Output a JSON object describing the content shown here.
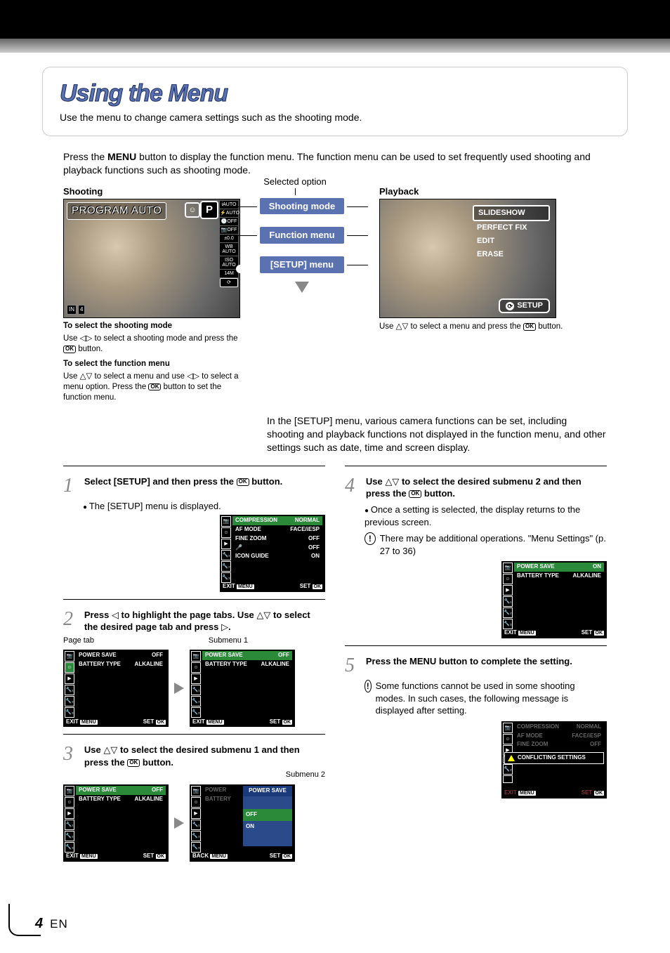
{
  "page": {
    "number": "4",
    "lang": "EN"
  },
  "title": "Using the Menu",
  "subtitle": "Use the menu to change camera settings such as the shooting mode.",
  "intro": "Press the MENU button to display the function menu. The function menu can be used to set frequently used shooting and playback functions such as shooting mode.",
  "labels": {
    "shooting": "Shooting",
    "selected_option": "Selected option",
    "playback": "Playback",
    "shooting_mode": "Shooting mode",
    "function_menu": "Function menu",
    "setup_menu": "[SETUP] menu"
  },
  "shooting_lcd": {
    "mode_banner": "PROGRAM AUTO",
    "p_letter": "P",
    "strip": [
      "iAUTO",
      "⚡AUTO",
      "🕓OFF",
      "📷OFF",
      "±0.0",
      "WB AUTO",
      "ISO AUTO",
      "14M",
      "⟳"
    ],
    "bl_left": "IN",
    "bl_right": "4"
  },
  "shooting_help": {
    "t1": "To select the shooting mode",
    "l1a": "Use ",
    "l1b": " to select a shooting mode and press the ",
    "l1c": " button.",
    "t2": "To select the function menu",
    "l2a": "Use ",
    "l2b": " to select a menu and use ",
    "l2c": " to select a menu option. Press the ",
    "l2d": " button to set the function menu."
  },
  "playback_menu": {
    "items": [
      "SLIDESHOW",
      "PERFECT FIX",
      "EDIT",
      "ERASE"
    ],
    "setup": "SETUP"
  },
  "playback_help": {
    "a": "Use ",
    "b": " to select a menu and press the ",
    "c": " button."
  },
  "setup_desc": "In the [SETUP] menu, various camera functions can be set, including shooting and playback functions not displayed in the function menu, and other settings such as date, time and screen display.",
  "steps": {
    "s1": {
      "head": "Select [SETUP] and then press the OK button.",
      "b1": "The [SETUP] menu is displayed."
    },
    "s2": {
      "head": "Press ◁ to highlight the page tabs. Use △▽ to select the desired page tab and press ▷.",
      "page_tab": "Page tab",
      "submenu1": "Submenu 1"
    },
    "s3": {
      "head": "Use △▽ to select the desired submenu 1 and then press the OK button.",
      "submenu2": "Submenu 2"
    },
    "s4": {
      "head": "Use △▽ to select the desired submenu 2 and then press the OK button.",
      "b1": "Once a setting is selected, the display returns to the previous screen.",
      "note": "There may be additional operations. \"Menu Settings\" (p. 27 to 36)"
    },
    "s5": {
      "head": "Press the MENU button to complete the setting.",
      "note": "Some functions cannot be used in some shooting modes. In such cases, the following message is displayed after setting.",
      "warn": "CONFLICTING SETTINGS"
    }
  },
  "lcd_tables": {
    "setup1": [
      [
        "COMPRESSION",
        "NORMAL"
      ],
      [
        "AF MODE",
        "FACE/iESP"
      ],
      [
        "FINE ZOOM",
        "OFF"
      ],
      [
        "🎤",
        "OFF"
      ],
      [
        "ICON GUIDE",
        "ON"
      ],
      [
        "",
        ""
      ]
    ],
    "power_off": [
      [
        "POWER SAVE",
        "OFF"
      ],
      [
        "BATTERY TYPE",
        "ALKALINE"
      ]
    ],
    "power_on": [
      [
        "POWER SAVE",
        "ON"
      ],
      [
        "BATTERY TYPE",
        "ALKALINE"
      ]
    ],
    "popup": {
      "title": "POWER SAVE",
      "opts": [
        "OFF",
        "ON"
      ]
    },
    "exit": "EXIT",
    "menu": "MENU",
    "set": "SET",
    "ok": "OK",
    "back": "BACK"
  },
  "ok_text": "OK"
}
